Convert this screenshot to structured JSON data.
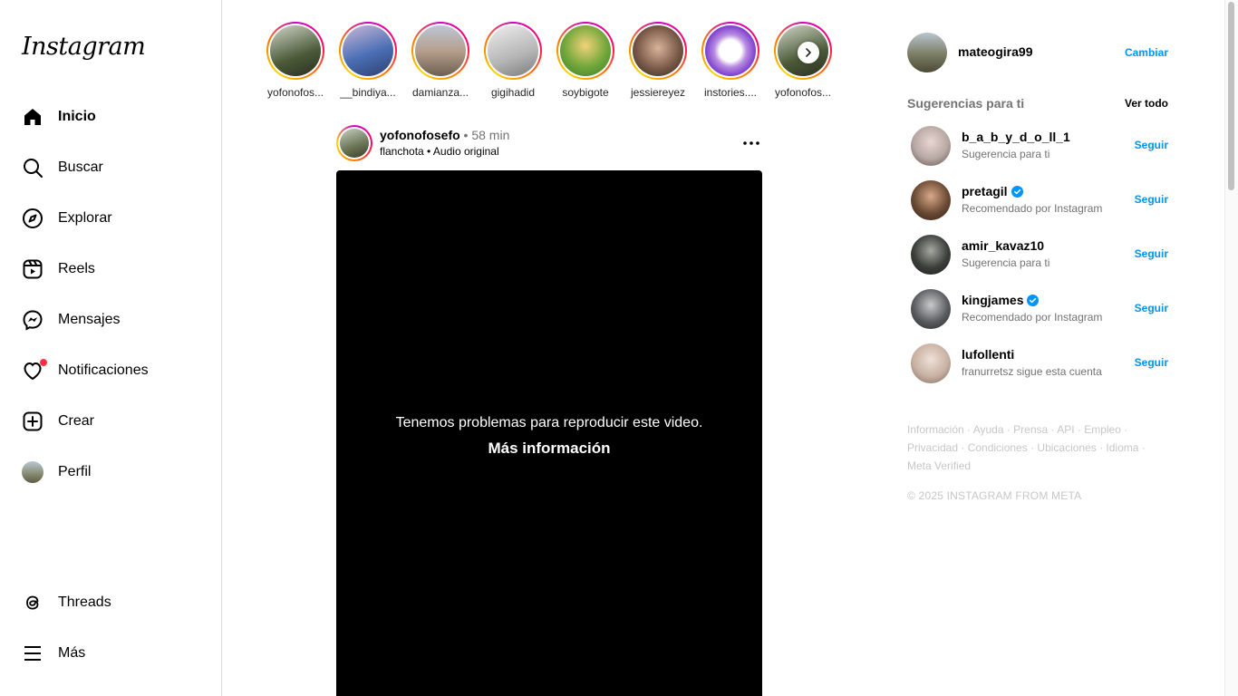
{
  "sidebar": {
    "logo": "Instagram",
    "items": [
      {
        "label": "Inicio",
        "icon": "home-icon"
      },
      {
        "label": "Buscar",
        "icon": "search-icon"
      },
      {
        "label": "Explorar",
        "icon": "compass-icon"
      },
      {
        "label": "Reels",
        "icon": "reels-icon"
      },
      {
        "label": "Mensajes",
        "icon": "messenger-icon"
      },
      {
        "label": "Notificaciones",
        "icon": "heart-icon"
      },
      {
        "label": "Crear",
        "icon": "plus-square-icon"
      },
      {
        "label": "Perfil",
        "icon": "avatar"
      },
      {
        "label": "Threads",
        "icon": "threads-icon"
      },
      {
        "label": "Más",
        "icon": "menu-icon"
      }
    ]
  },
  "stories": [
    {
      "name": "yofonofos...",
      "color": "#3e4a32"
    },
    {
      "name": "__bindiya...",
      "color": "#4b6fb5"
    },
    {
      "name": "damianza...",
      "color": "#a79b8a"
    },
    {
      "name": "gigihadid",
      "color": "#c9c9c9"
    },
    {
      "name": "soybigote",
      "color": "#6fa63a"
    },
    {
      "name": "jessiereyez",
      "color": "#7a5a48"
    },
    {
      "name": "instories....",
      "color": "#b98de0"
    },
    {
      "name": "yofonofos...",
      "color": "#3e4a32"
    }
  ],
  "post": {
    "username": "yofonofosefo",
    "time": " • 58 min",
    "music_user": "flanchota",
    "separator": " • ",
    "audio": "Audio original",
    "video_error": "Tenemos problemas para reproducir este video.",
    "video_more": "Más información"
  },
  "right": {
    "me": {
      "username": "mateogira99",
      "switch": "Cambiar"
    },
    "suggestions_title": "Sugerencias para ti",
    "see_all": "Ver todo",
    "follow_label": "Seguir",
    "suggestions": [
      {
        "username": "b_a_b_y_d_o_ll_1",
        "sub": "Sugerencia para ti",
        "verified": false,
        "color": "#b7a7a2"
      },
      {
        "username": "pretagil",
        "sub": "Recomendado por Instagram",
        "verified": true,
        "color": "#6b4a34"
      },
      {
        "username": "amir_kavaz10",
        "sub": "Sugerencia para ti",
        "verified": false,
        "color": "#3b3f3a"
      },
      {
        "username": "kingjames",
        "sub": "Recomendado por Instagram",
        "verified": true,
        "color": "#5a5d5f"
      },
      {
        "username": "lufollenti",
        "sub": "franurretsz sigue esta cuenta",
        "verified": false,
        "color": "#c8b1a3"
      }
    ],
    "footer_lines": [
      "Información · Ayuda · Prensa · API · Empleo ·",
      "Privacidad · Condiciones · Ubicaciones · Idioma ·",
      "Meta Verified"
    ],
    "copyright": "© 2025 INSTAGRAM FROM META"
  },
  "colors": {
    "accent": "#0095f6",
    "notification": "#ff3040"
  }
}
